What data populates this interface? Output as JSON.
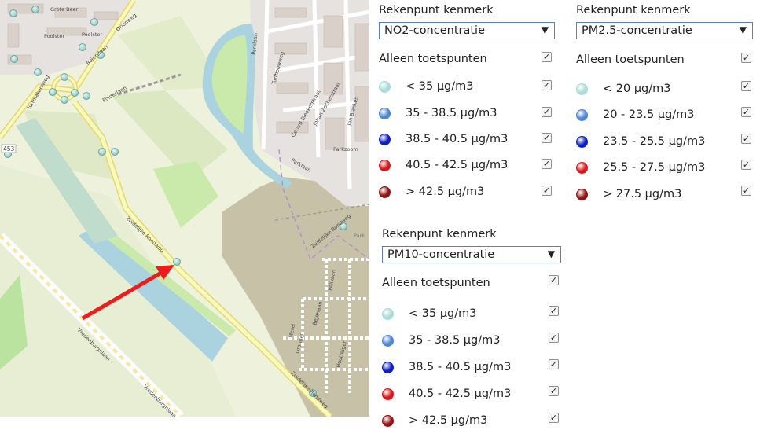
{
  "map": {
    "street_labels": [
      "Grote Beer",
      "Poolster",
      "Poolster",
      "Bejerslaan",
      "Orionweg",
      "Polderlaan",
      "Zuidelijke Rondweg",
      "Vredenburghlaan",
      "Vredenburghlaan",
      "Zuidelijke Rondweg",
      "Parklaan",
      "Parklaan",
      "Parkzoom",
      "Gerard Bleekerstraat",
      "Johan Zocherstraat",
      "Jan Blanken",
      "Turfhouwweg",
      "Merel",
      "Pelikaan",
      "Grondel",
      "Houtreiger",
      "Bejerlaan",
      "Turfmakersweg",
      "Zuidelijke Rondweg"
    ],
    "road_number": "453",
    "arrow_color": "#ee1c1c"
  },
  "panels": [
    {
      "title": "Rekenpunt kenmerk",
      "selected": "NO2-concentratie",
      "toetspunten_label": "Alleen toetspunten",
      "legend": [
        {
          "label": "< 35 μg/m3",
          "color": "#a9dcd6"
        },
        {
          "label": "35 - 38.5 μg/m3",
          "color": "#4e86d6"
        },
        {
          "label": "38.5 - 40.5 μg/m3",
          "color": "#0d1fc0"
        },
        {
          "label": "40.5 - 42.5 μg/m3",
          "color": "#d9161a"
        },
        {
          "label": "> 42.5 μg/m3",
          "color": "#951313"
        }
      ]
    },
    {
      "title": "Rekenpunt kenmerk",
      "selected": "PM2.5-concentratie",
      "toetspunten_label": "Alleen toetspunten",
      "legend": [
        {
          "label": "< 20 μg/m3",
          "color": "#a9dcd6"
        },
        {
          "label": "20 - 23.5 μg/m3",
          "color": "#4e86d6"
        },
        {
          "label": "23.5 - 25.5 μg/m3",
          "color": "#0d1fc0"
        },
        {
          "label": "25.5 - 27.5 μg/m3",
          "color": "#d9161a"
        },
        {
          "label": "> 27.5 μg/m3",
          "color": "#951313"
        }
      ]
    },
    {
      "title": "Rekenpunt kenmerk",
      "selected": "PM10-concentratie",
      "toetspunten_label": "Alleen toetspunten",
      "legend": [
        {
          "label": "< 35 μg/m3",
          "color": "#a9dcd6"
        },
        {
          "label": "35 - 38.5 μg/m3",
          "color": "#4e86d6"
        },
        {
          "label": "38.5 - 40.5 μg/m3",
          "color": "#0d1fc0"
        },
        {
          "label": "40.5 - 42.5 μg/m3",
          "color": "#d9161a"
        },
        {
          "label": "> 42.5 μg/m3",
          "color": "#951313"
        }
      ]
    }
  ]
}
